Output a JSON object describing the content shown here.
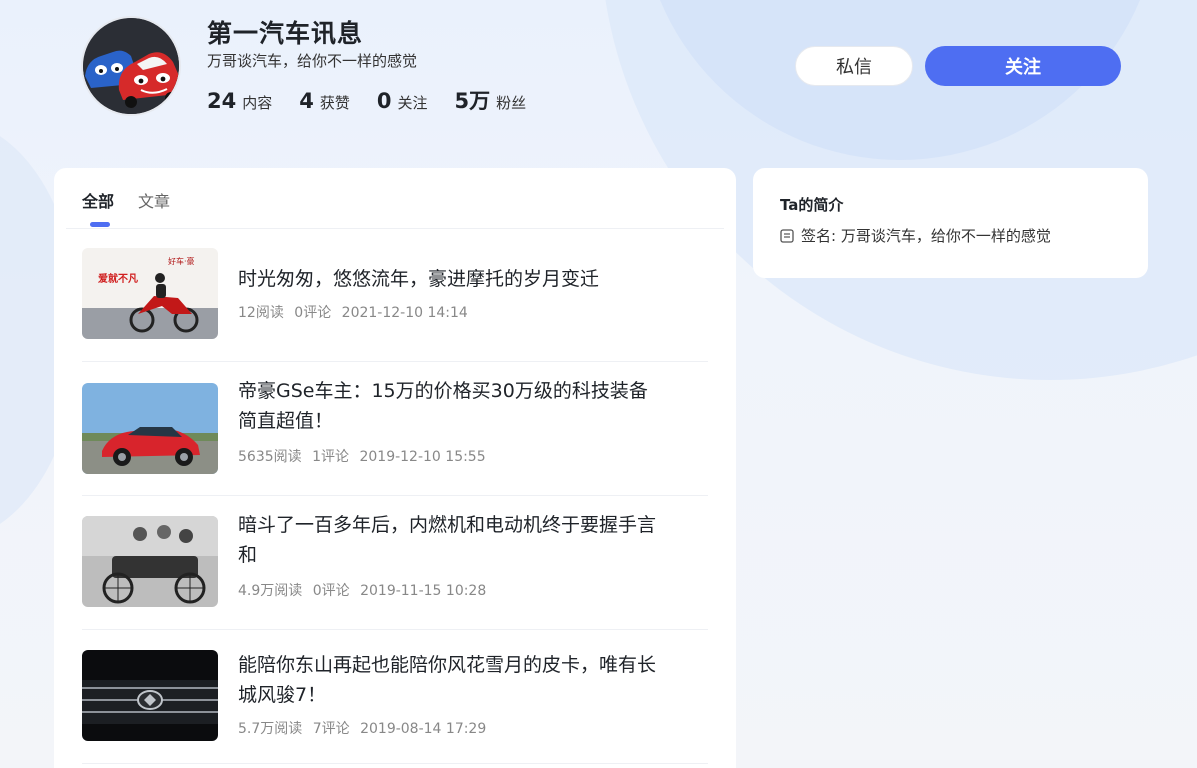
{
  "profile": {
    "name": "第一汽车讯息",
    "signature": "万哥谈汽车，给你不一样的感觉",
    "stats": [
      {
        "value": "24",
        "label": "内容"
      },
      {
        "value": "4",
        "label": "获赞"
      },
      {
        "value": "0",
        "label": "关注"
      },
      {
        "value": "5万",
        "label": "粉丝"
      }
    ]
  },
  "actions": {
    "message_label": "私信",
    "follow_label": "关注"
  },
  "tabs": [
    {
      "label": "全部",
      "active": true
    },
    {
      "label": "文章",
      "active": false
    }
  ],
  "articles": [
    {
      "title": "时光匆匆，悠悠流年，豪进摩托的岁月变迁",
      "reads": "12阅读",
      "comments": "0评论",
      "date": "2021-12-10 14:14",
      "thumb": "motorcycle-thumbnail"
    },
    {
      "title": "帝豪GSe车主：15万的价格买30万级的科技装备 简直超值！",
      "reads": "5635阅读",
      "comments": "1评论",
      "date": "2019-12-10 15:55",
      "thumb": "red-suv-thumbnail"
    },
    {
      "title": "暗斗了一百多年后，内燃机和电动机终于要握手言和",
      "reads": "4.9万阅读",
      "comments": "0评论",
      "date": "2019-11-15 10:28",
      "thumb": "vintage-car-thumbnail"
    },
    {
      "title": "能陪你东山再起也能陪你风花雪月的皮卡，唯有长城风骏7！",
      "reads": "5.7万阅读",
      "comments": "7评论",
      "date": "2019-08-14 17:29",
      "thumb": "grille-thumbnail"
    }
  ],
  "intro": {
    "title": "Ta的简介",
    "signature_text": "签名: 万哥谈汽车，给你不一样的感觉"
  },
  "colors": {
    "accent": "#4e6ef2"
  }
}
